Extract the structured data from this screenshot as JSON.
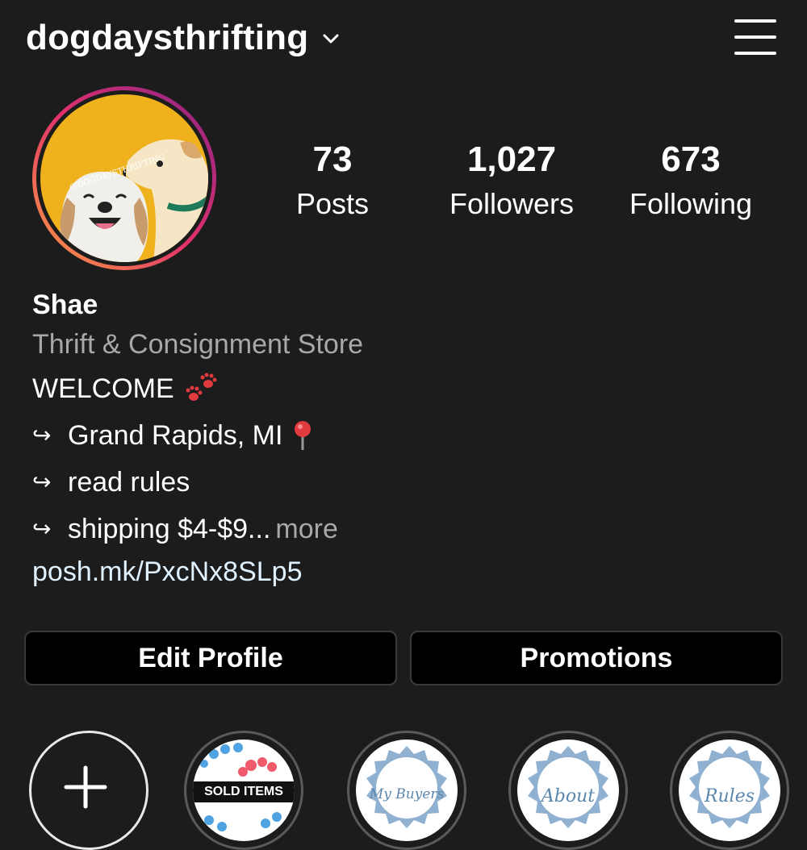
{
  "header": {
    "username": "dogdaysthrifting",
    "dropdown_icon": "chevron-down-icon",
    "menu_icon": "hamburger-menu-icon"
  },
  "avatar": {
    "watermark": "@DOGDAYSTHRIFTING",
    "ring_colors": [
      "#f58529",
      "#dd2a7b",
      "#8134af"
    ]
  },
  "stats": [
    {
      "value": "73",
      "label": "Posts"
    },
    {
      "value": "1,027",
      "label": "Followers"
    },
    {
      "value": "673",
      "label": "Following"
    }
  ],
  "bio": {
    "name": "Shae",
    "category": "Thrift & Consignment Store",
    "welcome": "WELCOME",
    "arrow": "↪",
    "lines": [
      "Grand Rapids, MI",
      "read rules",
      "shipping $4-$9..."
    ],
    "more": "more",
    "link": "posh.mk/PxcNx8SLp5"
  },
  "buttons": {
    "edit_profile": "Edit Profile",
    "promotions": "Promotions"
  },
  "highlights": [
    {
      "type": "new",
      "icon": "plus-icon"
    },
    {
      "label": "SOLD ITEMS"
    },
    {
      "label": "My Buyers"
    },
    {
      "label": "About"
    },
    {
      "label": "Rules"
    }
  ]
}
